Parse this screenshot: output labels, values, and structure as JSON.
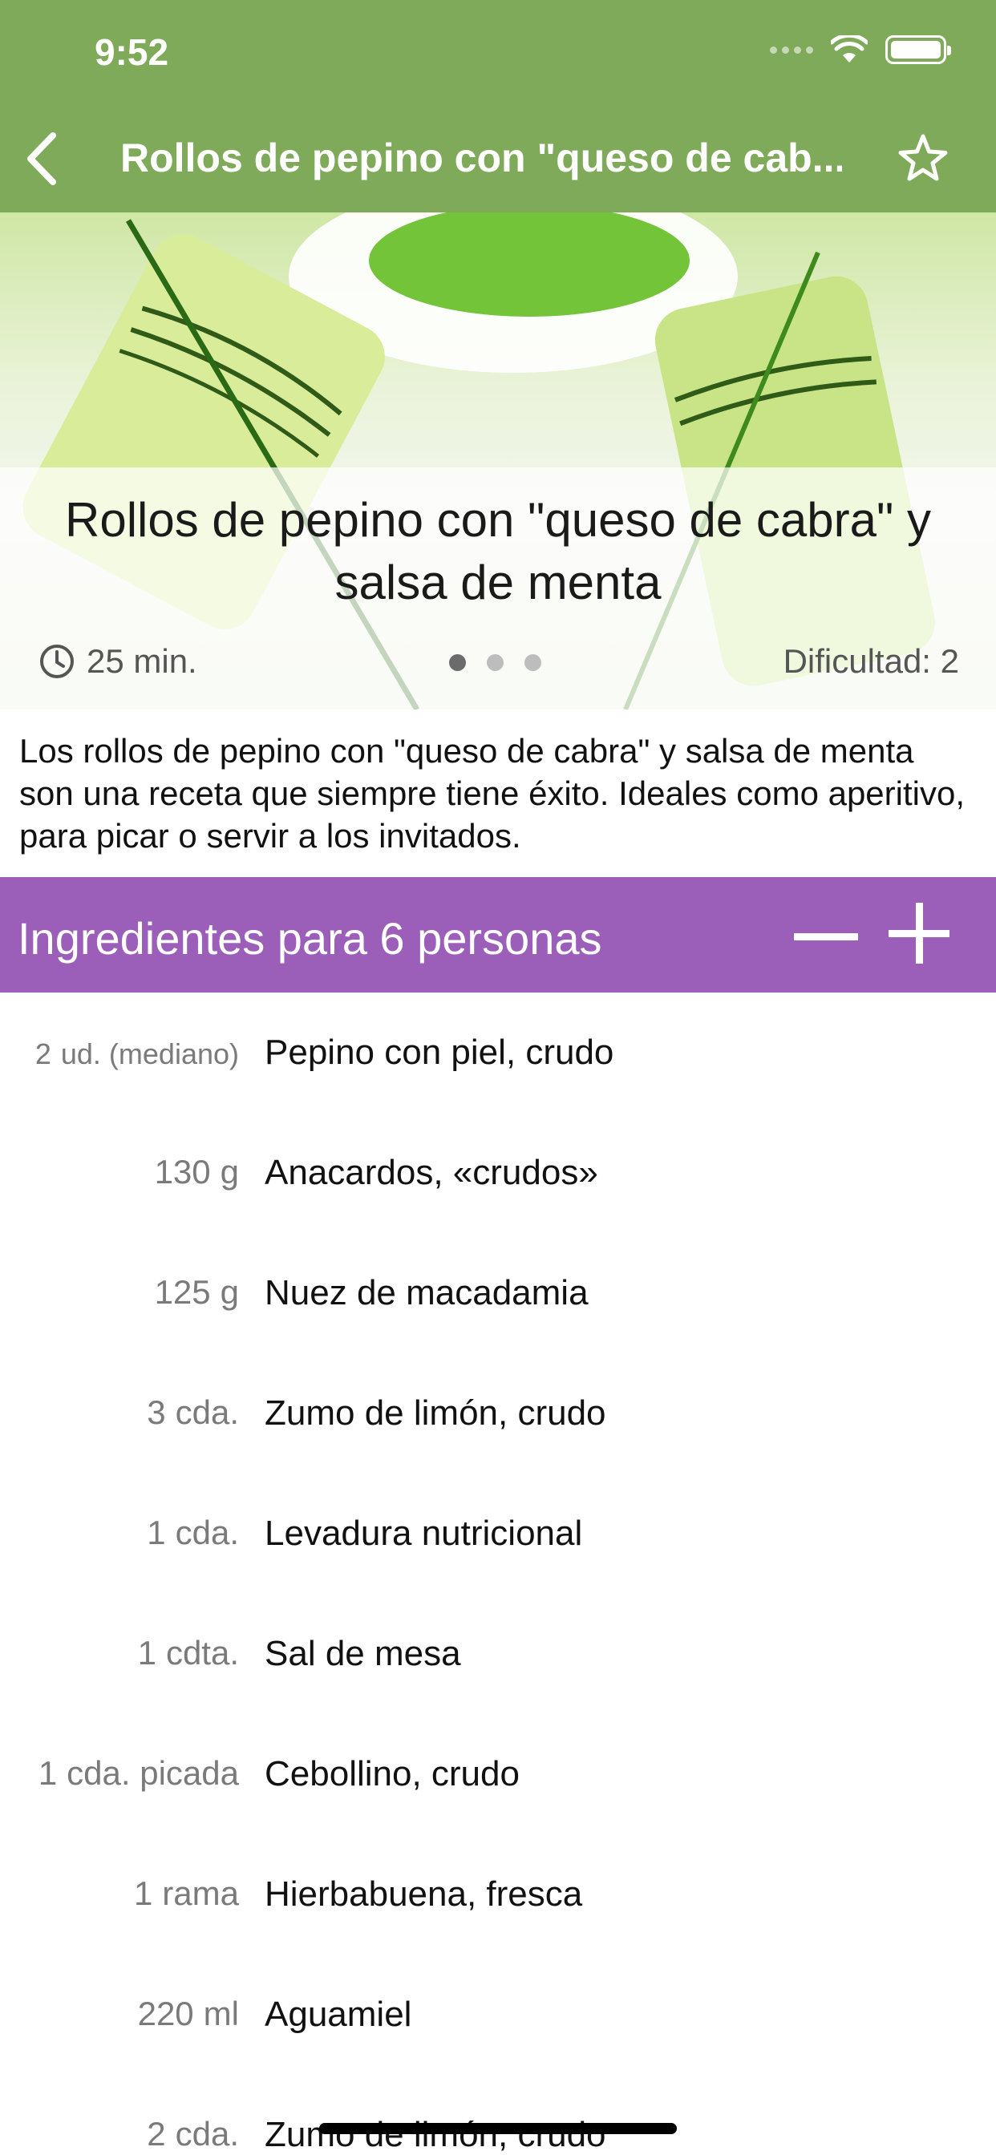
{
  "status_bar": {
    "time": "9:52"
  },
  "nav": {
    "title": "Rollos de pepino con \"queso de cab..."
  },
  "hero": {
    "title": "Rollos de pepino con \"queso de cabra\" y salsa de menta",
    "time": "25 min.",
    "difficulty": "Dificultad: 2",
    "carousel_pages": 3,
    "carousel_active": 1
  },
  "description": "Los rollos de pepino con \"queso de cabra\" y salsa de menta son una receta que siempre tiene éxito. Ideales como aperitivo, para picar o servir a los invitados.",
  "ingredients_header": {
    "title": "Ingredientes para 6 personas"
  },
  "ingredients": [
    {
      "amount": "2",
      "unit": "ud. (mediano)",
      "name": "Pepino con piel, crudo"
    },
    {
      "amount": "130",
      "unit": "g",
      "name": "Anacardos, «crudos»"
    },
    {
      "amount": "125",
      "unit": "g",
      "name": "Nuez de macadamia"
    },
    {
      "amount": "3",
      "unit": "cda.",
      "name": "Zumo de limón, crudo"
    },
    {
      "amount": "1",
      "unit": "cda.",
      "name": "Levadura nutricional"
    },
    {
      "amount": "1",
      "unit": "cdta.",
      "name": "Sal de mesa"
    },
    {
      "amount": "1",
      "unit": "cda. picada",
      "name": "Cebollino, crudo"
    },
    {
      "amount": "1",
      "unit": "rama",
      "name": "Hierbabuena, fresca"
    },
    {
      "amount": "220",
      "unit": "ml",
      "name": "Aguamiel"
    },
    {
      "amount": "2",
      "unit": "cda.",
      "name": "Zumo de limón, crudo"
    }
  ],
  "colors": {
    "nav_bar": "#7faa5a",
    "ingredients_header": "#9b5fba"
  },
  "icons": {
    "back": "chevron-left-icon",
    "favorite": "star-outline-icon",
    "time": "clock-icon"
  }
}
